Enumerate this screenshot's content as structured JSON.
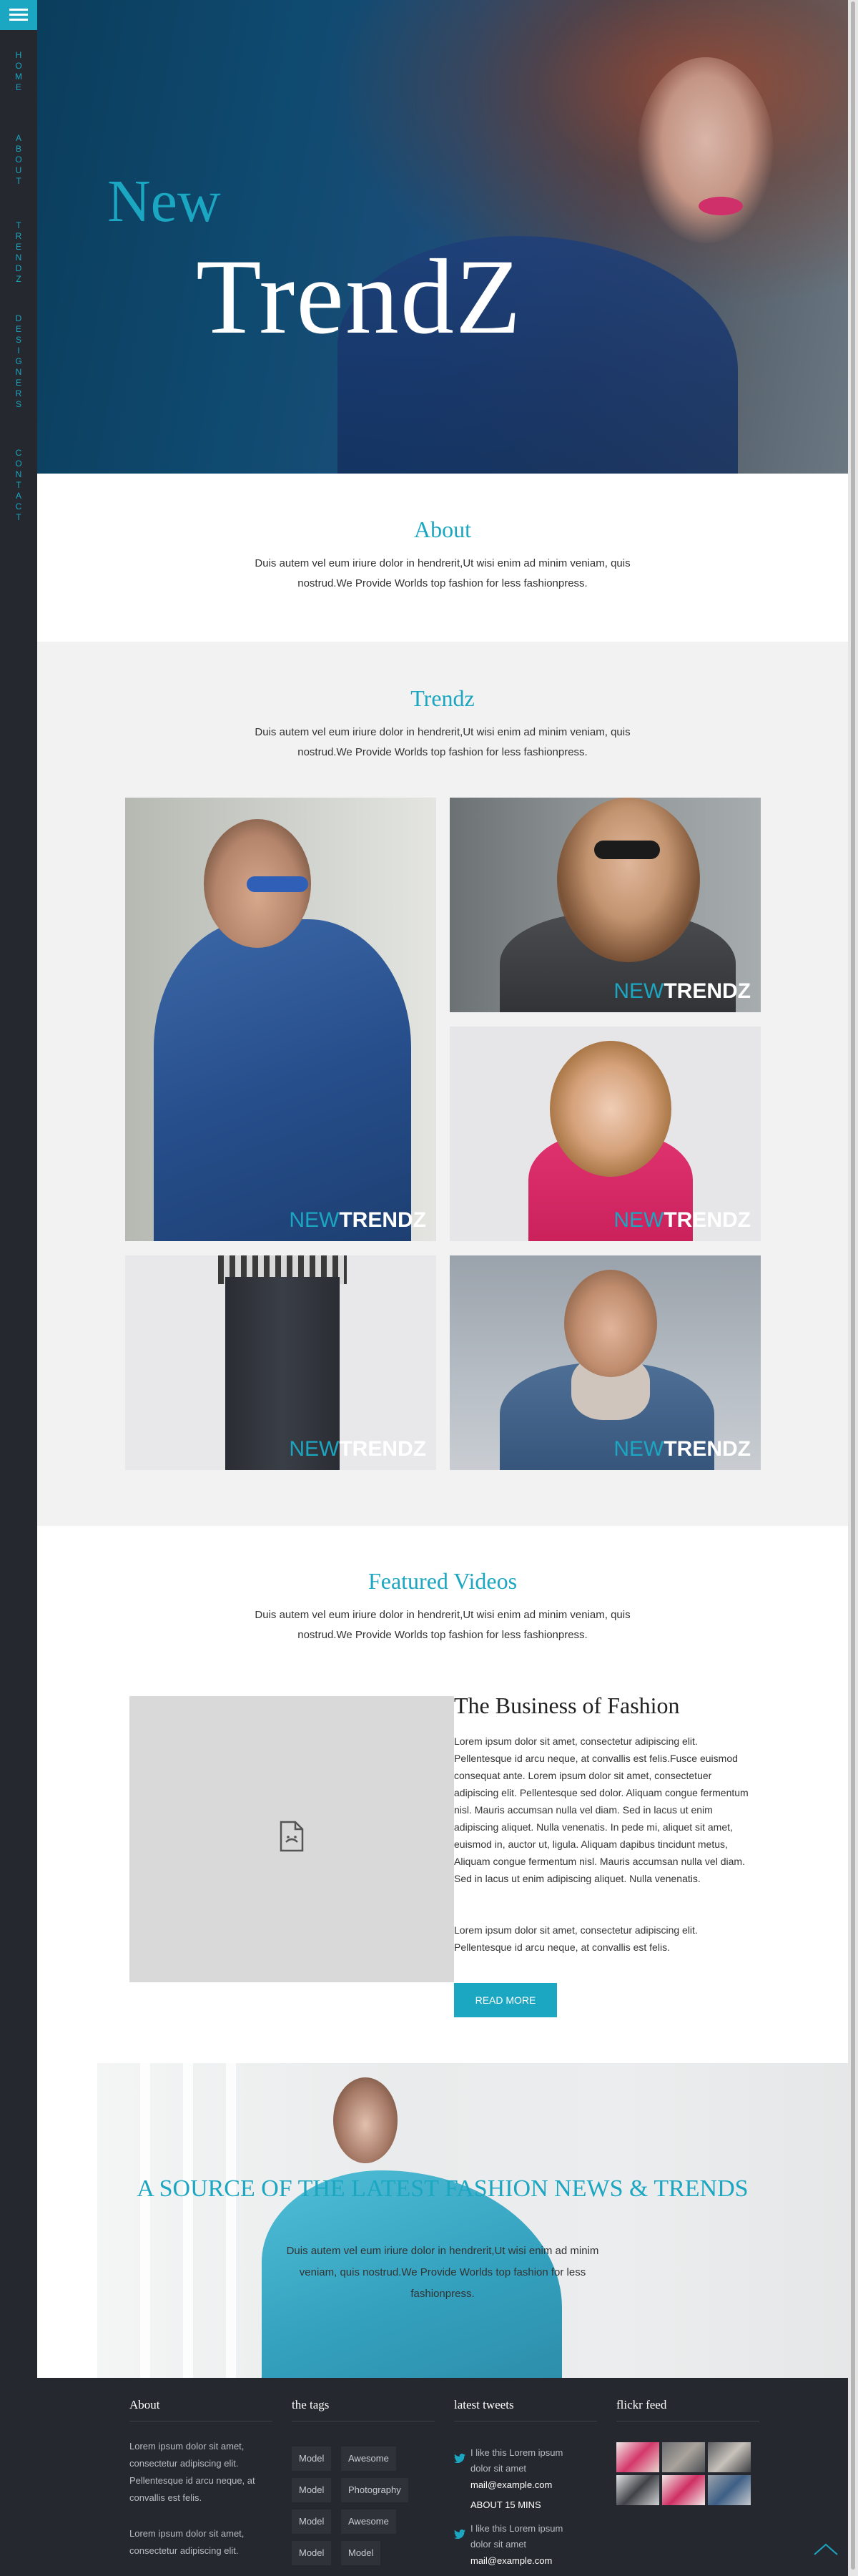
{
  "colors": {
    "accent": "#1ba6c1",
    "sidebar": "#25282e",
    "footer": "#25282e",
    "light_bg": "#f2f2f2"
  },
  "sidebar": {
    "menu_icon": "hamburger-icon",
    "items": [
      {
        "label": "Home"
      },
      {
        "label": "About"
      },
      {
        "label": "TrendZ"
      },
      {
        "label": "Designers"
      },
      {
        "label": "Contact"
      }
    ]
  },
  "hero": {
    "title_small": "New",
    "title_large": "TrendZ"
  },
  "about": {
    "title": "About",
    "text": "Duis autem vel eum iriure dolor in hendrerit,Ut wisi enim ad minim veniam, quis nostrud.We Provide Worlds top fashion for less fashionpress."
  },
  "trendz": {
    "title": "Trendz",
    "text": "Duis autem vel eum iriure dolor in hendrerit,Ut wisi enim ad minim veniam, quis nostrud.We Provide Worlds top fashion for less fashionpress.",
    "caption_new": "NEW",
    "caption_trendz": "TRENDZ"
  },
  "videos": {
    "title": "Featured Videos",
    "text": "Duis autem vel eum iriure dolor in hendrerit,Ut wisi enim ad minim veniam, quis nostrud.We Provide Worlds top fashion for less fashionpress.",
    "player_icon": "broken-file-icon",
    "article_title": "The Business of Fashion",
    "article_p1": "Lorem ipsum dolor sit amet, consectetur adipiscing elit. Pellentesque id arcu neque, at convallis est felis.Fusce euismod consequat ante. Lorem ipsum dolor sit amet, consectetuer adipiscing elit. Pellentesque sed dolor. Aliquam congue fermentum nisl. Mauris accumsan nulla vel diam. Sed in lacus ut enim adipiscing aliquet. Nulla venenatis. In pede mi, aliquet sit amet, euismod in, auctor ut, ligula. Aliquam dapibus tincidunt metus, Aliquam congue fermentum nisl. Mauris accumsan nulla vel diam. Sed in lacus ut enim adipiscing aliquet. Nulla venenatis.",
    "article_p2": "Lorem ipsum dolor sit amet, consectetur adipiscing elit. Pellentesque id arcu neque, at convallis est felis.",
    "button": "Read More"
  },
  "banner": {
    "title": "A SOURCE OF THE LATEST FASHION NEWS & TRENDS",
    "text": "Duis autem vel eum iriure dolor in hendrerit,Ut wisi enim ad minim veniam, quis nostrud.We Provide Worlds top fashion for less fashionpress."
  },
  "footer": {
    "about": {
      "heading": "About",
      "p1": "Lorem ipsum dolor sit amet, consectetur adipiscing elit. Pellentesque id arcu neque, at convallis est felis.",
      "p2": "Lorem ipsum dolor sit amet, consectetur adipiscing elit."
    },
    "tags": {
      "heading": "the tags",
      "items": [
        "Model",
        "Awesome",
        "Model",
        "Photography",
        "Model",
        "Awesome",
        "Model",
        "Model"
      ]
    },
    "tweets": {
      "heading": "latest tweets",
      "icon": "twitter-bird-icon",
      "items": [
        {
          "text": "I like this Lorem ipsum dolor sit amet",
          "mail": "mail@example.com",
          "time": "About 15 mins"
        },
        {
          "text": "I like this Lorem ipsum dolor sit amet",
          "mail": "mail@example.com"
        }
      ]
    },
    "flickr": {
      "heading": "flickr feed"
    },
    "to_top_icon": "chevron-up-icon"
  }
}
